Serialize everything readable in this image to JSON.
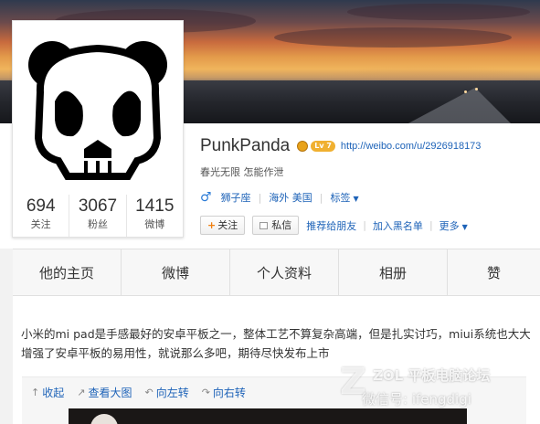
{
  "profile": {
    "name": "PunkPanda",
    "level_badge": "Lv 7",
    "home_url": "http://weibo.com/u/2926918173",
    "intro": "春光无限 怎能作泄",
    "gender_icon": "male-icon",
    "zodiac": "狮子座",
    "location": "海外 美国",
    "tags": "标签"
  },
  "stats": [
    {
      "count": "694",
      "label": "关注"
    },
    {
      "count": "3067",
      "label": "粉丝"
    },
    {
      "count": "1415",
      "label": "微博"
    }
  ],
  "actions": {
    "follow": "关注",
    "message": "私信",
    "recommend": "推荐给朋友",
    "blacklist": "加入黑名单",
    "more": "更多"
  },
  "tabs": [
    "他的主页",
    "微博",
    "个人资料",
    "相册",
    "赞"
  ],
  "post": {
    "text": "小米的mi pad是手感最好的安卓平板之一，整体工艺不算复杂高端，但是扎实讨巧，miui系统也大大增强了安卓平板的易用性，就说那么多吧，期待尽快发布上市",
    "media_actions": [
      "收起",
      "查看大图",
      "向左转",
      "向右转"
    ]
  },
  "watermark": {
    "line1": "ZOL 平板电脑论坛",
    "line2": "微信号: ifengdigi"
  },
  "colors": {
    "link": "#1e63b8",
    "level_badge": "#f0b030",
    "follow_plus": "#f08010"
  }
}
